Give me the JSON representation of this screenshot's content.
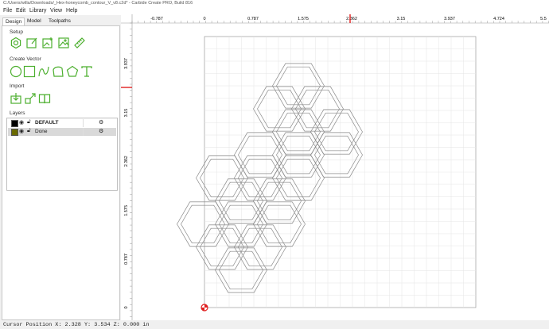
{
  "window": {
    "title": "C:/Users/willa/Downloads/_Hex-honeycomb_contour_V_v8.c2d* - Carbide Create PRO, Build 816"
  },
  "menu": [
    {
      "label": "File"
    },
    {
      "label": "Edit"
    },
    {
      "label": "Library"
    },
    {
      "label": "View"
    },
    {
      "label": "Help"
    }
  ],
  "tabs": [
    {
      "label": "Design"
    },
    {
      "label": "Model"
    },
    {
      "label": "Toolpaths"
    }
  ],
  "sections": {
    "setup": "Setup",
    "create_vector": "Create Vector",
    "import": "Import",
    "layers": "Layers"
  },
  "setup_icons": [
    "gear-hex-icon",
    "edit-document-icon",
    "add-image-icon",
    "image-icon",
    "ruler-icon"
  ],
  "vector_icons": [
    "circle-icon",
    "rectangle-icon",
    "curve-icon",
    "polygon-shape-icon",
    "pentagon-icon",
    "text-tool-icon"
  ],
  "import_icons": [
    "import-file-icon",
    "import-vector-icon",
    "library-book-icon"
  ],
  "layers": [
    {
      "name": "DEFAULT",
      "color": "#000000",
      "bold": true
    },
    {
      "name": "Done",
      "color": "#6b6b00",
      "bold": false
    }
  ],
  "ruler": {
    "top": [
      "-0.787",
      "0",
      "0.787",
      "1.575",
      "2.362",
      "3.15",
      "3.937",
      "4.724",
      "5.5"
    ],
    "left": [
      "3.937",
      "3.15",
      "2.362",
      "1.575",
      "0.787",
      "0"
    ]
  },
  "status": {
    "text": "Cursor Position X: 2.328 Y: 3.534 Z: 0.000 in"
  },
  "colors": {
    "accent": "#4caf2e",
    "cursor": "#e02020",
    "grid": "#e6e6e6",
    "hex": "#8a8a8a"
  }
}
